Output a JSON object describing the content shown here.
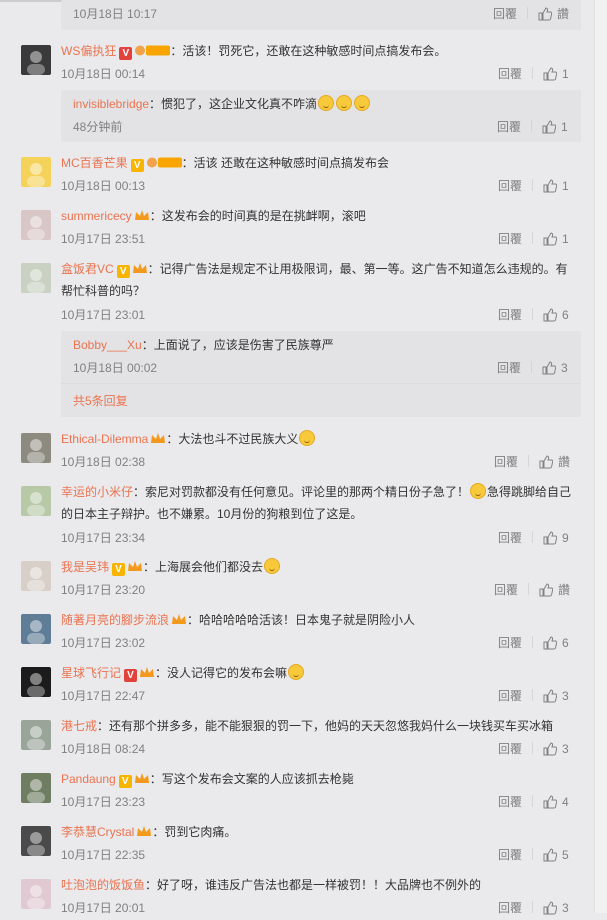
{
  "ui": {
    "reply_label": "回覆",
    "like_text": "讚"
  },
  "top_partial": {
    "time": "10月18日 10:17",
    "reply": "回覆",
    "like": "讚"
  },
  "comments": [
    {
      "name": "WS偏执狂",
      "text": "：活该！罚死它，还敢在这种敏感时间点搞发布会。",
      "time": "10月18日 00:14",
      "likes": "1",
      "sub": {
        "name": "invisiblebridge",
        "text": "：惯犯了，这企业文化真不咋滴",
        "time": "48分钟前",
        "likes": "1"
      }
    },
    {
      "name": "MC百香芒果",
      "text": "：活该 还敢在这种敏感时间点搞发布会",
      "time": "10月18日 00:13",
      "likes": "1"
    },
    {
      "name": "summericecy",
      "text": "：这发布会的时间真的是在挑衅啊，滚吧",
      "time": "10月17日 23:51",
      "likes": "1"
    },
    {
      "name": "盒饭君VC",
      "text": "：记得广告法是规定不让用极限词，最、第一等。这广告不知道怎么违规的。有",
      "text2": "帮忙科普的吗？",
      "time": "10月17日 23:01",
      "likes": "6",
      "sub": {
        "name": "Bobby___Xu",
        "text": "：上面说了，应该是伤害了民族尊严",
        "time": "10月18日 00:02",
        "likes": "3",
        "more": "共5条回复"
      }
    },
    {
      "name": "Ethical-Dilemma",
      "text": "：大法也斗不过民族大义",
      "time": "10月18日 02:38",
      "likes": "讚"
    },
    {
      "name": "幸运的小米仔",
      "text": "：索尼对罚款都没有任何意见。评论里的那两个精日份子急了！",
      "text_b": "急得跳脚给自己",
      "text2": "的日本主子辩护。也不嫌累。10月份的狗粮到位了这是。",
      "time": "10月17日 23:34",
      "likes": "9"
    },
    {
      "name": "我是吴玮",
      "text": "：上海展会他们都没去",
      "time": "10月17日 23:20",
      "likes": "讚"
    },
    {
      "name": "随著月亮的腳步流浪",
      "text": "：哈哈哈哈哈活该！日本鬼子就是阴险小人",
      "time": "10月17日 23:02",
      "likes": "6"
    },
    {
      "name": "星球飞行记",
      "text": "：没人记得它的发布会嘛",
      "time": "10月17日 22:47",
      "likes": "3"
    },
    {
      "name": "港七戒",
      "text": "：还有那个拼多多，能不能狠狠的罚一下，他妈的天天忽悠我妈什么一块钱买车买冰箱",
      "time": "10月18日 08:24",
      "likes": "3"
    },
    {
      "name": "Pandaung",
      "text": "：写这个发布会文案的人应该抓去枪毙",
      "time": "10月17日 23:23",
      "likes": "4"
    },
    {
      "name": "李恭慧Crystal",
      "text": "：罚到它肉痛。",
      "time": "10月17日 22:35",
      "likes": "5"
    },
    {
      "name": "吐泡泡的饭饭鱼",
      "text": "：好了呀，谁违反广告法也都是一样被罚！！大品牌也不例外的",
      "time": "10月17日 20:01",
      "likes": "3"
    }
  ],
  "colors": {
    "accent": "#eb7350",
    "meta": "#808080",
    "bg": "#eaeaec",
    "subbg": "#e3e3e6"
  }
}
